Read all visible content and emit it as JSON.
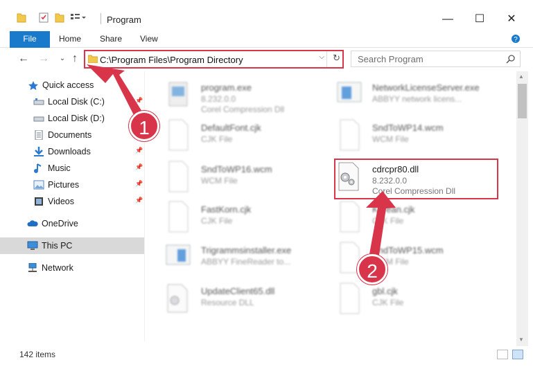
{
  "window": {
    "title": "Program",
    "minimize": "—",
    "maximize": "☐",
    "close": "✕"
  },
  "ribbon": {
    "file": "File",
    "tabs": [
      "Home",
      "Share",
      "View"
    ]
  },
  "address": {
    "path": "C:\\Program Files\\Program Directory",
    "search_placeholder": "Search Program"
  },
  "sidebar": {
    "items": [
      {
        "label": "Quick access",
        "icon": "star-icon",
        "pinned": false
      },
      {
        "label": "Local Disk (C:)",
        "icon": "drive-icon",
        "pinned": true
      },
      {
        "label": "Local Disk (D:)",
        "icon": "drive-icon",
        "pinned": false
      },
      {
        "label": "Documents",
        "icon": "documents-icon",
        "pinned": true
      },
      {
        "label": "Downloads",
        "icon": "download-icon",
        "pinned": true
      },
      {
        "label": "Music",
        "icon": "music-icon",
        "pinned": true
      },
      {
        "label": "Pictures",
        "icon": "pictures-icon",
        "pinned": true
      },
      {
        "label": "Videos",
        "icon": "videos-icon",
        "pinned": true
      },
      {
        "label": "OneDrive",
        "icon": "cloud-icon",
        "pinned": false
      },
      {
        "label": "This PC",
        "icon": "computer-icon",
        "pinned": false,
        "selected": true
      },
      {
        "label": "Network",
        "icon": "network-icon",
        "pinned": false
      }
    ]
  },
  "files": [
    {
      "name": "program.exe",
      "version": "8.232.0.0",
      "desc": "Corel Compression Dll",
      "type": "exe"
    },
    {
      "name": "NetworkLicenseServer.exe",
      "version": "ABBYY network licens...",
      "desc": "",
      "type": "app"
    },
    {
      "name": "DefaultFont.cjk",
      "version": "CJK File",
      "desc": "",
      "type": "doc"
    },
    {
      "name": "SndToWP14.wcm",
      "version": "WCM File",
      "desc": "",
      "type": "doc"
    },
    {
      "name": "SndToWP16.wcm",
      "version": "WCM File",
      "desc": "",
      "type": "doc"
    },
    {
      "name": "cdrcpr80.dll",
      "version": "8.232.0.0",
      "desc": "Corel Compression Dll",
      "type": "dll"
    },
    {
      "name": "FastKorn.cjk",
      "version": "CJK File",
      "desc": "",
      "type": "doc"
    },
    {
      "name": "Korean.cjk",
      "version": "CJK File",
      "desc": "",
      "type": "doc"
    },
    {
      "name": "Trigrammsinstaller.exe",
      "version": "ABBYY FineReader to...",
      "desc": "",
      "type": "app"
    },
    {
      "name": "SndToWP15.wcm",
      "version": "WCM File",
      "desc": "",
      "type": "doc"
    },
    {
      "name": "UpdateClient65.dll",
      "version": "Resource DLL",
      "desc": "",
      "type": "dll"
    },
    {
      "name": "gbl.cjk",
      "version": "CJK File",
      "desc": "",
      "type": "doc"
    }
  ],
  "status": {
    "count": "142 items"
  },
  "annotations": {
    "badge1": "1",
    "badge2": "2"
  },
  "colors": {
    "accent": "#1979ca",
    "annotation": "#d9354a",
    "selection": "#d9d9d9"
  }
}
